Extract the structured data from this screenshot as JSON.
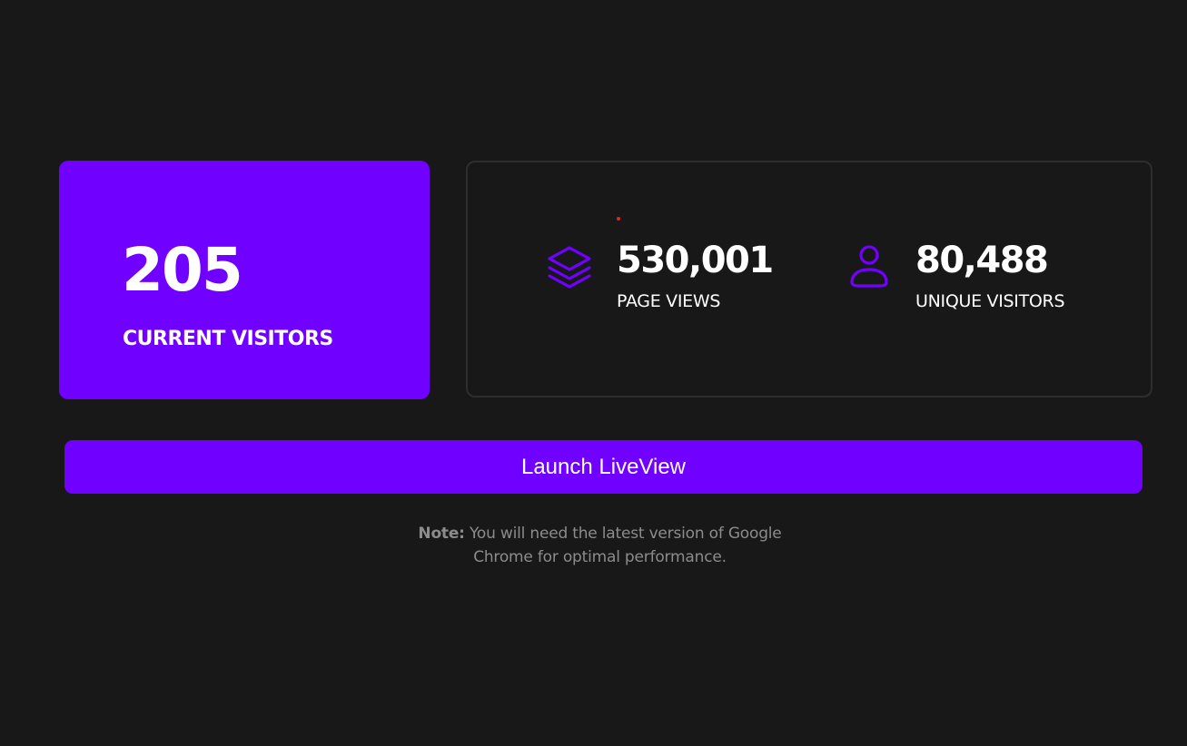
{
  "current_visitors": {
    "value": "205",
    "label": "CURRENT VISITORS"
  },
  "stats": {
    "page_views": {
      "icon": "layers-icon",
      "value": "530,001",
      "label": "PAGE VIEWS"
    },
    "unique_visitors": {
      "icon": "user-icon",
      "value": "80,488",
      "label": "UNIQUE VISITORS"
    }
  },
  "launch_button": {
    "label": "Launch LiveView"
  },
  "note": {
    "prefix": "Note:",
    "text": " You will need the latest version of Google Chrome for optimal performance."
  },
  "colors": {
    "background": "#181818",
    "accent": "#7000ff",
    "text": "#ffffff",
    "muted": "#8c8c8c",
    "indicator": "#e0281e"
  }
}
